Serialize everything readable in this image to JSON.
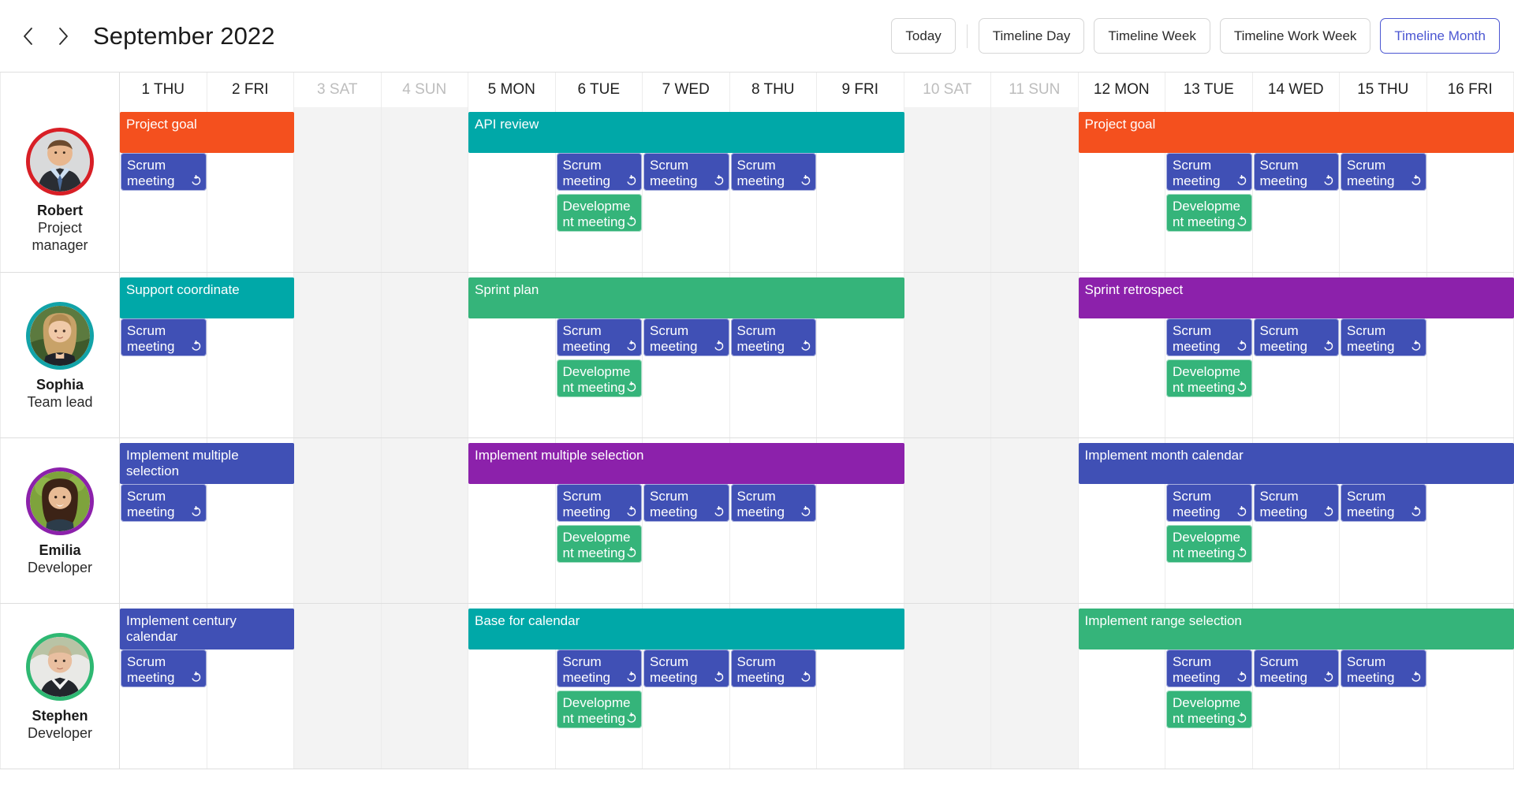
{
  "toolbar": {
    "prev_label": "‹",
    "next_label": "›",
    "title": "September 2022",
    "today_label": "Today",
    "views": [
      {
        "label": "Timeline Day",
        "active": false
      },
      {
        "label": "Timeline Week",
        "active": false
      },
      {
        "label": "Timeline Work Week",
        "active": false
      },
      {
        "label": "Timeline Month",
        "active": true
      }
    ],
    "accent_color": "#4b56d2"
  },
  "columns": [
    {
      "label": "1 THU",
      "weekend": false
    },
    {
      "label": "2 FRI",
      "weekend": false
    },
    {
      "label": "3 SAT",
      "weekend": true
    },
    {
      "label": "4 SUN",
      "weekend": true
    },
    {
      "label": "5 MON",
      "weekend": false
    },
    {
      "label": "6 TUE",
      "weekend": false
    },
    {
      "label": "7 WED",
      "weekend": false
    },
    {
      "label": "8 THU",
      "weekend": false
    },
    {
      "label": "9 FRI",
      "weekend": false
    },
    {
      "label": "10 SAT",
      "weekend": true
    },
    {
      "label": "11 SUN",
      "weekend": true
    },
    {
      "label": "12 MON",
      "weekend": false
    },
    {
      "label": "13 TUE",
      "weekend": false
    },
    {
      "label": "14 WED",
      "weekend": false
    },
    {
      "label": "15 THU",
      "weekend": false
    },
    {
      "label": "16 FRI",
      "weekend": false
    }
  ],
  "event_colors": {
    "orange": "#f4501e",
    "teal": "#00a8a8",
    "green": "#35b47a",
    "purple": "#8c21ab",
    "blue": "#4050b5"
  },
  "recurrence_icon": "recurrence-icon",
  "resources": [
    {
      "name": "Robert",
      "role": "Project manager",
      "ring_color": "#d81f26",
      "avatar": "avatar-robert",
      "events": [
        {
          "text": "Project goal",
          "color": "orange",
          "start": 0,
          "span": 2,
          "lane": 0,
          "recurring": false
        },
        {
          "text": "Scrum meeting",
          "color": "blue",
          "start": 0,
          "span": 1,
          "lane": 1,
          "recurring": true
        },
        {
          "text": "API review",
          "color": "teal",
          "start": 4,
          "span": 5,
          "lane": 0,
          "recurring": false
        },
        {
          "text": "Scrum meeting",
          "color": "blue",
          "start": 5,
          "span": 1,
          "lane": 1,
          "recurring": true
        },
        {
          "text": "Scrum meeting",
          "color": "blue",
          "start": 6,
          "span": 1,
          "lane": 1,
          "recurring": true
        },
        {
          "text": "Scrum meeting",
          "color": "blue",
          "start": 7,
          "span": 1,
          "lane": 1,
          "recurring": true
        },
        {
          "text": "Development meeting",
          "color": "green",
          "start": 5,
          "span": 1,
          "lane": 2,
          "recurring": true
        },
        {
          "text": "Project goal",
          "color": "orange",
          "start": 11,
          "span": 5,
          "lane": 0,
          "recurring": false
        },
        {
          "text": "Scrum meeting",
          "color": "blue",
          "start": 12,
          "span": 1,
          "lane": 1,
          "recurring": true
        },
        {
          "text": "Scrum meeting",
          "color": "blue",
          "start": 13,
          "span": 1,
          "lane": 1,
          "recurring": true
        },
        {
          "text": "Scrum meeting",
          "color": "blue",
          "start": 14,
          "span": 1,
          "lane": 1,
          "recurring": true
        },
        {
          "text": "Development meeting",
          "color": "green",
          "start": 12,
          "span": 1,
          "lane": 2,
          "recurring": true
        }
      ]
    },
    {
      "name": "Sophia",
      "role": "Team lead",
      "ring_color": "#12a3a8",
      "avatar": "avatar-sophia",
      "events": [
        {
          "text": "Support coordinate",
          "color": "teal",
          "start": 0,
          "span": 2,
          "lane": 0,
          "recurring": false
        },
        {
          "text": "Scrum meeting",
          "color": "blue",
          "start": 0,
          "span": 1,
          "lane": 1,
          "recurring": true
        },
        {
          "text": "Sprint plan",
          "color": "green",
          "start": 4,
          "span": 5,
          "lane": 0,
          "recurring": false
        },
        {
          "text": "Scrum meeting",
          "color": "blue",
          "start": 5,
          "span": 1,
          "lane": 1,
          "recurring": true
        },
        {
          "text": "Scrum meeting",
          "color": "blue",
          "start": 6,
          "span": 1,
          "lane": 1,
          "recurring": true
        },
        {
          "text": "Scrum meeting",
          "color": "blue",
          "start": 7,
          "span": 1,
          "lane": 1,
          "recurring": true
        },
        {
          "text": "Development meeting",
          "color": "green",
          "start": 5,
          "span": 1,
          "lane": 2,
          "recurring": true
        },
        {
          "text": "Sprint retrospect",
          "color": "purple",
          "start": 11,
          "span": 5,
          "lane": 0,
          "recurring": false
        },
        {
          "text": "Scrum meeting",
          "color": "blue",
          "start": 12,
          "span": 1,
          "lane": 1,
          "recurring": true
        },
        {
          "text": "Scrum meeting",
          "color": "blue",
          "start": 13,
          "span": 1,
          "lane": 1,
          "recurring": true
        },
        {
          "text": "Scrum meeting",
          "color": "blue",
          "start": 14,
          "span": 1,
          "lane": 1,
          "recurring": true
        },
        {
          "text": "Development meeting",
          "color": "green",
          "start": 12,
          "span": 1,
          "lane": 2,
          "recurring": true
        }
      ]
    },
    {
      "name": "Emilia",
      "role": "Developer",
      "ring_color": "#8c21ab",
      "avatar": "avatar-emilia",
      "events": [
        {
          "text": "Implement multiple selection",
          "color": "blue",
          "start": 0,
          "span": 2,
          "lane": 0,
          "recurring": false
        },
        {
          "text": "Scrum meeting",
          "color": "blue",
          "start": 0,
          "span": 1,
          "lane": 1,
          "recurring": true
        },
        {
          "text": "Implement multiple selection",
          "color": "purple",
          "start": 4,
          "span": 5,
          "lane": 0,
          "recurring": false
        },
        {
          "text": "Scrum meeting",
          "color": "blue",
          "start": 5,
          "span": 1,
          "lane": 1,
          "recurring": true
        },
        {
          "text": "Scrum meeting",
          "color": "blue",
          "start": 6,
          "span": 1,
          "lane": 1,
          "recurring": true
        },
        {
          "text": "Scrum meeting",
          "color": "blue",
          "start": 7,
          "span": 1,
          "lane": 1,
          "recurring": true
        },
        {
          "text": "Development meeting",
          "color": "green",
          "start": 5,
          "span": 1,
          "lane": 2,
          "recurring": true
        },
        {
          "text": "Implement month calendar",
          "color": "blue",
          "start": 11,
          "span": 5,
          "lane": 0,
          "recurring": false
        },
        {
          "text": "Scrum meeting",
          "color": "blue",
          "start": 12,
          "span": 1,
          "lane": 1,
          "recurring": true
        },
        {
          "text": "Scrum meeting",
          "color": "blue",
          "start": 13,
          "span": 1,
          "lane": 1,
          "recurring": true
        },
        {
          "text": "Scrum meeting",
          "color": "blue",
          "start": 14,
          "span": 1,
          "lane": 1,
          "recurring": true
        },
        {
          "text": "Development meeting",
          "color": "green",
          "start": 12,
          "span": 1,
          "lane": 2,
          "recurring": true
        }
      ]
    },
    {
      "name": "Stephen",
      "role": "Developer",
      "ring_color": "#2eb872",
      "avatar": "avatar-stephen",
      "events": [
        {
          "text": "Implement century calendar",
          "color": "blue",
          "start": 0,
          "span": 2,
          "lane": 0,
          "recurring": false
        },
        {
          "text": "Scrum meeting",
          "color": "blue",
          "start": 0,
          "span": 1,
          "lane": 1,
          "recurring": true
        },
        {
          "text": "Base for calendar",
          "color": "teal",
          "start": 4,
          "span": 5,
          "lane": 0,
          "recurring": false
        },
        {
          "text": "Scrum meeting",
          "color": "blue",
          "start": 5,
          "span": 1,
          "lane": 1,
          "recurring": true
        },
        {
          "text": "Scrum meeting",
          "color": "blue",
          "start": 6,
          "span": 1,
          "lane": 1,
          "recurring": true
        },
        {
          "text": "Scrum meeting",
          "color": "blue",
          "start": 7,
          "span": 1,
          "lane": 1,
          "recurring": true
        },
        {
          "text": "Development meeting",
          "color": "green",
          "start": 5,
          "span": 1,
          "lane": 2,
          "recurring": true
        },
        {
          "text": "Implement range selection",
          "color": "green",
          "start": 11,
          "span": 5,
          "lane": 0,
          "recurring": false
        },
        {
          "text": "Scrum meeting",
          "color": "blue",
          "start": 12,
          "span": 1,
          "lane": 1,
          "recurring": true
        },
        {
          "text": "Scrum meeting",
          "color": "blue",
          "start": 13,
          "span": 1,
          "lane": 1,
          "recurring": true
        },
        {
          "text": "Scrum meeting",
          "color": "blue",
          "start": 14,
          "span": 1,
          "lane": 1,
          "recurring": true
        },
        {
          "text": "Development meeting",
          "color": "green",
          "start": 12,
          "span": 1,
          "lane": 2,
          "recurring": true
        }
      ]
    }
  ]
}
